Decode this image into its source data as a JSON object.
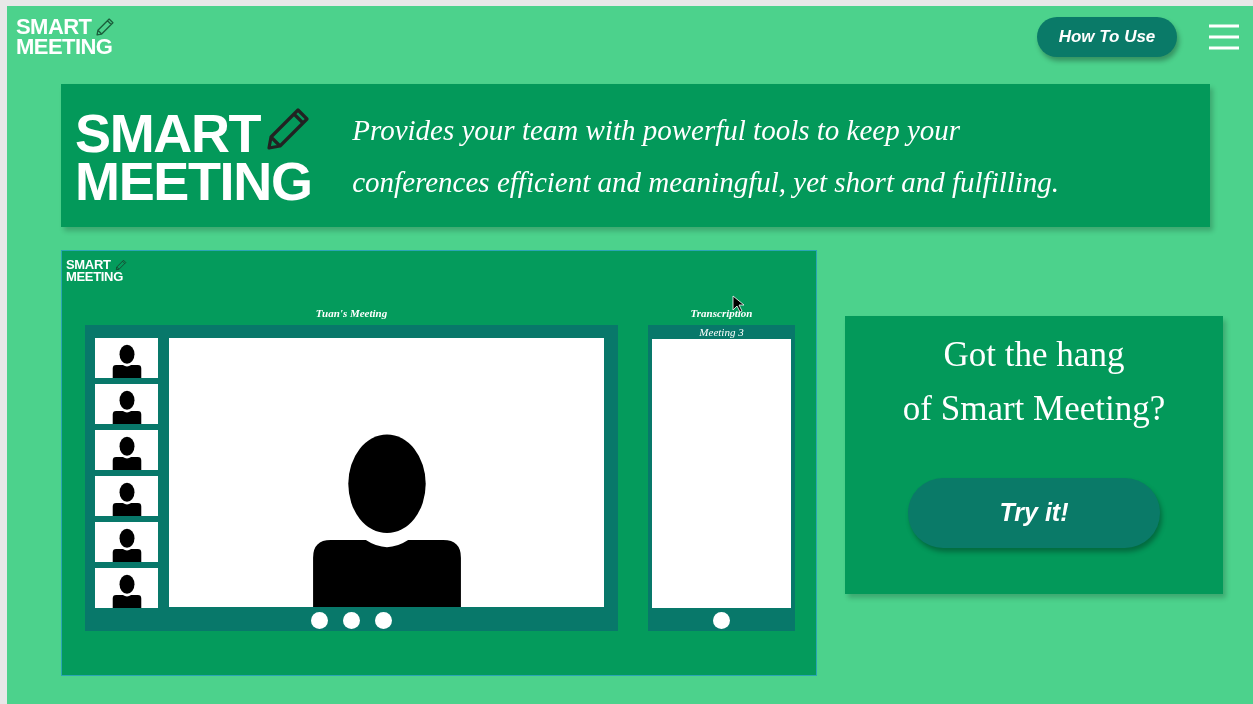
{
  "header": {
    "logo": [
      "SMART",
      "MEETING"
    ],
    "how_to_use_button": "How To Use"
  },
  "banner": {
    "logo": [
      "SMART",
      "MEETING"
    ],
    "tagline_lines": [
      "Provides your team with powerful tools to keep your",
      "conferences efficient and meaningful, yet short and fulfilling."
    ]
  },
  "preview": {
    "logo": [
      "SMART",
      "MEETING"
    ],
    "meeting_title": "Tuan's Meeting",
    "transcription_title": "Transcription",
    "transcription_meeting": "Meeting 3"
  },
  "cta": {
    "heading_lines": [
      "Got the hang",
      "of Smart Meeting?"
    ],
    "button": "Try it!"
  }
}
